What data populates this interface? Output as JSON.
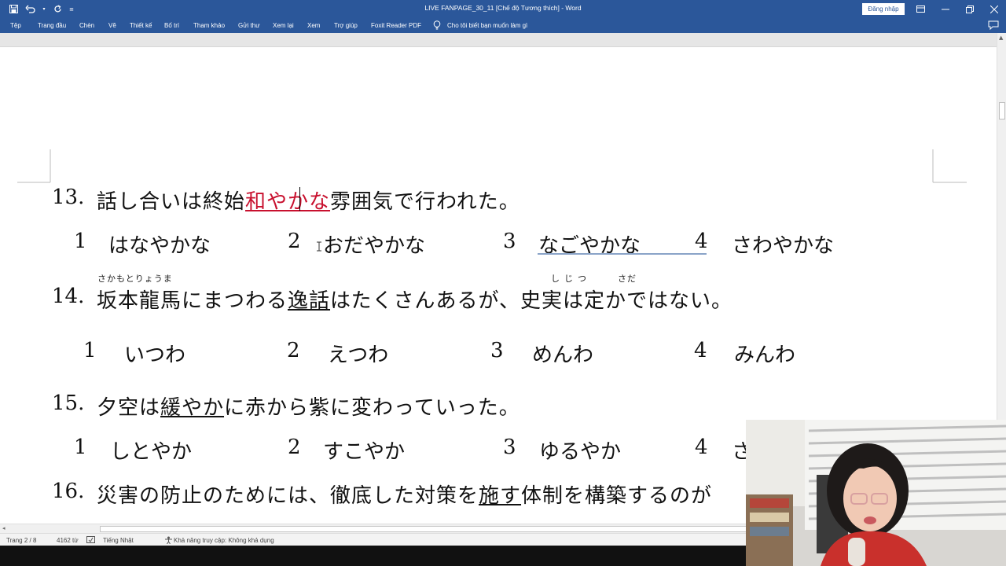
{
  "window": {
    "title": "LIVE FANPAGE_30_11 [Chế độ Tương thích]  -  Word",
    "signin_label": "Đăng nhập"
  },
  "ribbon": {
    "tabs": [
      "Tệp",
      "Trang đầu",
      "Chèn",
      "Vẽ",
      "Thiết kế",
      "Bố trí",
      "Tham khảo",
      "Gửi thư",
      "Xem lại",
      "Xem",
      "Trợ giúp",
      "Foxit Reader PDF"
    ],
    "tell_me": "Cho tôi biết bạn muốn làm gì"
  },
  "document": {
    "questions": [
      {
        "number": "13.",
        "before": "話し合いは終始",
        "target": "和やかな",
        "after": "雰囲気で行われた。",
        "options": [
          {
            "num": "1",
            "text": "はなやかな"
          },
          {
            "num": "2",
            "text": "おだやかな"
          },
          {
            "num": "3",
            "text": "なごやかな"
          },
          {
            "num": "4",
            "text": "さわやかな"
          }
        ]
      },
      {
        "number": "14.",
        "furigana_1": "さかもとりょうま",
        "furigana_2": "しじつ",
        "furigana_3": "さだ",
        "part_a": "坂本龍馬にまつわる",
        "target": "逸話",
        "part_b": "はたくさんあるが、",
        "part_c": "史実は",
        "part_d": "定",
        "part_e": "かではない。",
        "options": [
          {
            "num": "1",
            "text": "いつわ"
          },
          {
            "num": "2",
            "text": "えつわ"
          },
          {
            "num": "3",
            "text": "めんわ"
          },
          {
            "num": "4",
            "text": "みんわ"
          }
        ]
      },
      {
        "number": "15.",
        "before": "夕空は",
        "target": "緩やか",
        "after": "に赤から紫に変わっていった。",
        "options": [
          {
            "num": "1",
            "text": "しとやか"
          },
          {
            "num": "2",
            "text": "すこやか"
          },
          {
            "num": "3",
            "text": "ゆるやか"
          },
          {
            "num": "4",
            "text": "さ"
          }
        ]
      },
      {
        "number": "16.",
        "before": "災害の防止のためには、徹底した対策を",
        "target": "施す",
        "after": "体制を構築するのが"
      }
    ]
  },
  "statusbar": {
    "page": "Trang 2 / 8",
    "words": "4162 từ",
    "language": "Tiếng Nhật",
    "accessibility": "Khả năng truy cập: Không khả dụng"
  },
  "colors": {
    "word_blue": "#2b579a",
    "highlight_red": "#c8102e"
  }
}
